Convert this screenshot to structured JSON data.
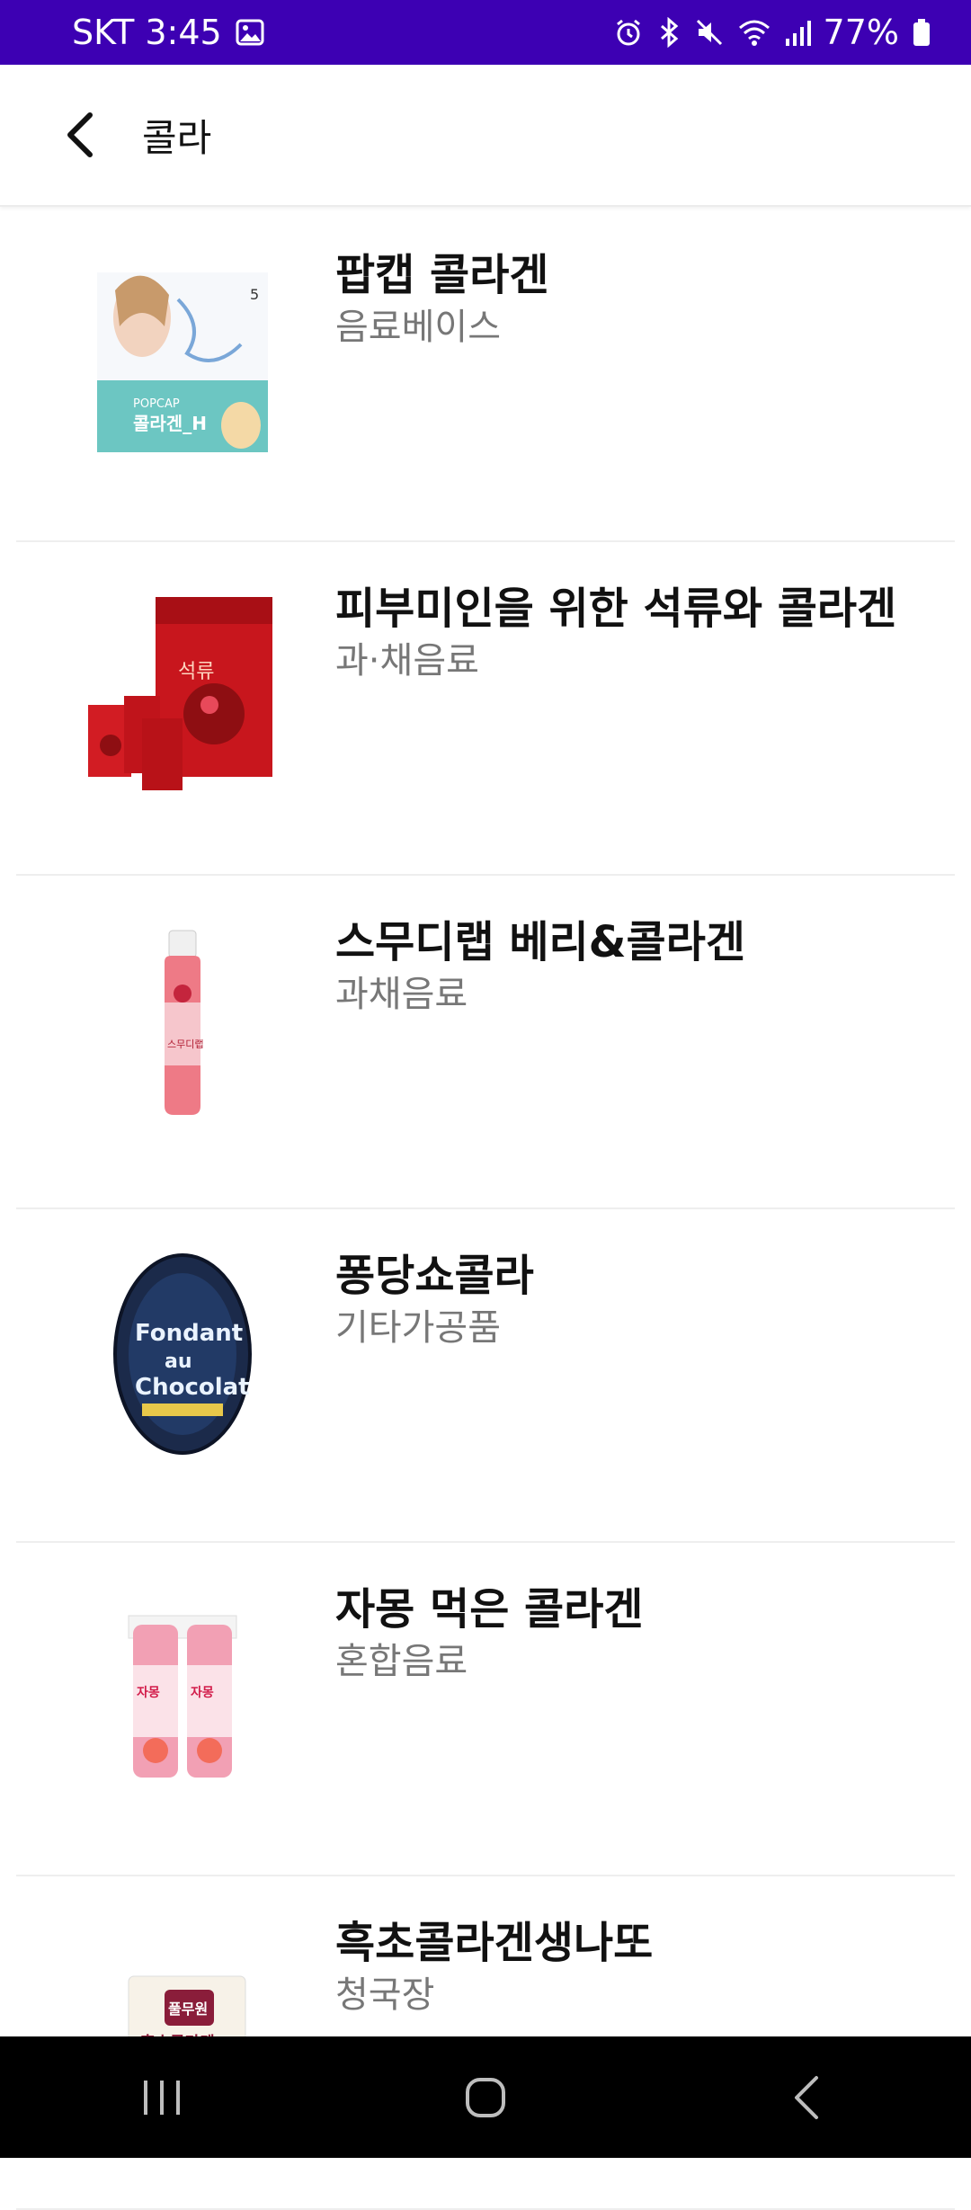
{
  "status_bar": {
    "carrier_time": "SKT 3:45",
    "battery": "77%",
    "icons": [
      "image-icon",
      "alarm-icon",
      "bluetooth-icon",
      "mute-icon",
      "wifi-icon",
      "signal-icon",
      "battery-icon"
    ],
    "background": "#3d00b3"
  },
  "header": {
    "title": "콜라",
    "back_icon": "back-arrow-icon"
  },
  "items": [
    {
      "name": "팝캡 콜라겐",
      "category": "음료베이스"
    },
    {
      "name": "피부미인을 위한 석류와 콜라겐",
      "category": "과·채음료"
    },
    {
      "name": "스무디랩 베리&콜라겐",
      "category": "과채음료"
    },
    {
      "name": "퐁당쇼콜라",
      "category": "기타가공품"
    },
    {
      "name": "자몽 먹은 콜라겐",
      "category": "혼합음료"
    },
    {
      "name": "흑초콜라겐생나또",
      "category": "청국장"
    }
  ],
  "nav": {
    "recents_icon": "recents-icon",
    "home_icon": "home-icon",
    "back_icon": "nav-back-icon"
  }
}
